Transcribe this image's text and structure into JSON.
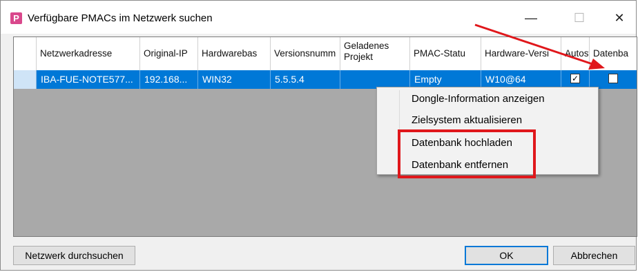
{
  "window": {
    "icon_letter": "P",
    "title": "Verfügbare PMACs im Netzwerk suchen",
    "minimize": "—",
    "maximize": "☐",
    "close": "✕"
  },
  "table": {
    "columns": [
      "Netzwerkadresse",
      "Original-IP",
      "Hardwarebas",
      "Versionsnumm",
      "Geladenes Projekt",
      "PMAC-Statu",
      "Hardware-Versi",
      "Autost",
      "Datenba"
    ],
    "rows": [
      {
        "netzwerkadresse": "IBA-FUE-NOTE577...",
        "original_ip": "192.168...",
        "hardwarebasis": "WIN32",
        "versionsnummer": "5.5.5.4",
        "geladenes_projekt": "",
        "pmac_status": "Empty",
        "hardware_version": "W10@64",
        "autostart_checked": "✓",
        "datenbank_checked": ""
      }
    ]
  },
  "context_menu": {
    "items": [
      "Dongle-Information anzeigen",
      "Zielsystem aktualisieren",
      "Datenbank hochladen",
      "Datenbank entfernen"
    ]
  },
  "buttons": {
    "search": "Netzwerk durchsuchen",
    "ok": "OK",
    "cancel": "Abbrechen"
  },
  "colors": {
    "selection": "#0078d7",
    "annotation": "#e0171b",
    "grid_background": "#a9a9a9"
  }
}
